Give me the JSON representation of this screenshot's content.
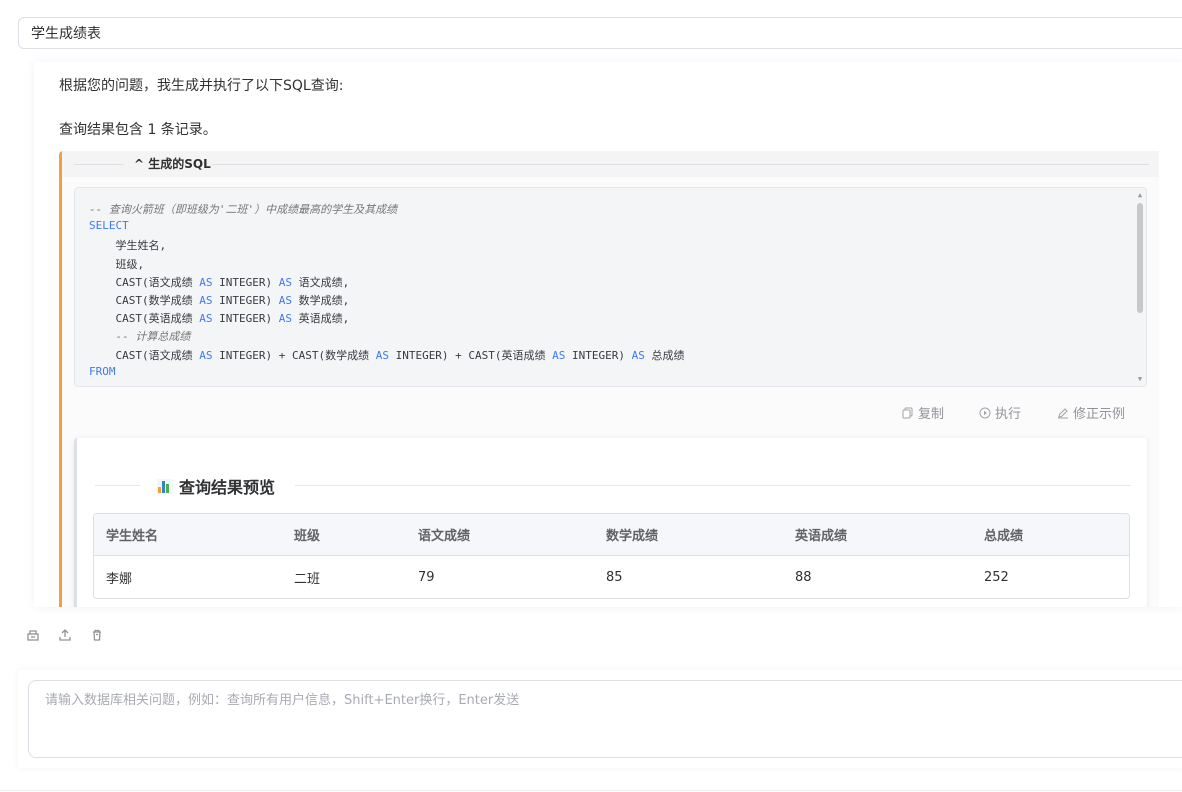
{
  "datasource": {
    "selected": "学生成绩表"
  },
  "message": {
    "intro": "根据您的问题，我生成并执行了以下SQL查询:",
    "summary": "查询结果包含 1 条记录。"
  },
  "sql_panel": {
    "title": "^ 生成的SQL",
    "code_lines": [
      [
        {
          "t": "-- 查询火箭班（即班级为'二班'）中成绩最高的学生及其成绩",
          "c": "cm"
        }
      ],
      [
        {
          "t": "SELECT",
          "c": "kw"
        }
      ],
      [
        {
          "t": "    学生姓名,",
          "c": ""
        }
      ],
      [
        {
          "t": "    班级,",
          "c": ""
        }
      ],
      [
        {
          "t": "    CAST(语文成绩 ",
          "c": ""
        },
        {
          "t": "AS",
          "c": "kw"
        },
        {
          "t": " INTEGER) ",
          "c": ""
        },
        {
          "t": "AS",
          "c": "kw"
        },
        {
          "t": " 语文成绩,",
          "c": ""
        }
      ],
      [
        {
          "t": "    CAST(数学成绩 ",
          "c": ""
        },
        {
          "t": "AS",
          "c": "kw"
        },
        {
          "t": " INTEGER) ",
          "c": ""
        },
        {
          "t": "AS",
          "c": "kw"
        },
        {
          "t": " 数学成绩,",
          "c": ""
        }
      ],
      [
        {
          "t": "    CAST(英语成绩 ",
          "c": ""
        },
        {
          "t": "AS",
          "c": "kw"
        },
        {
          "t": " INTEGER) ",
          "c": ""
        },
        {
          "t": "AS",
          "c": "kw"
        },
        {
          "t": " 英语成绩,",
          "c": ""
        }
      ],
      [
        {
          "t": "    -- 计算总成绩",
          "c": "cm"
        }
      ],
      [
        {
          "t": "    CAST(语文成绩 ",
          "c": ""
        },
        {
          "t": "AS",
          "c": "kw"
        },
        {
          "t": " INTEGER) + CAST(数学成绩 ",
          "c": ""
        },
        {
          "t": "AS",
          "c": "kw"
        },
        {
          "t": " INTEGER) + CAST(英语成绩 ",
          "c": ""
        },
        {
          "t": "AS",
          "c": "kw"
        },
        {
          "t": " INTEGER) ",
          "c": ""
        },
        {
          "t": "AS",
          "c": "kw"
        },
        {
          "t": " 总成绩",
          "c": ""
        }
      ],
      [
        {
          "t": "FROM",
          "c": "kw"
        }
      ]
    ],
    "actions": {
      "copy": "复制",
      "execute": "执行",
      "fix_example": "修正示例"
    }
  },
  "result": {
    "title": "查询结果预览",
    "columns": [
      "学生姓名",
      "班级",
      "语文成绩",
      "数学成绩",
      "英语成绩",
      "总成绩"
    ],
    "rows": [
      [
        "李娜",
        "二班",
        "79",
        "85",
        "88",
        "252"
      ]
    ]
  },
  "input": {
    "placeholder": "请输入数据库相关问题，例如：查询所有用户信息，Shift+Enter换行，Enter发送"
  },
  "colors": {
    "accent_border": "#f0a040",
    "keyword": "#4078f2"
  }
}
